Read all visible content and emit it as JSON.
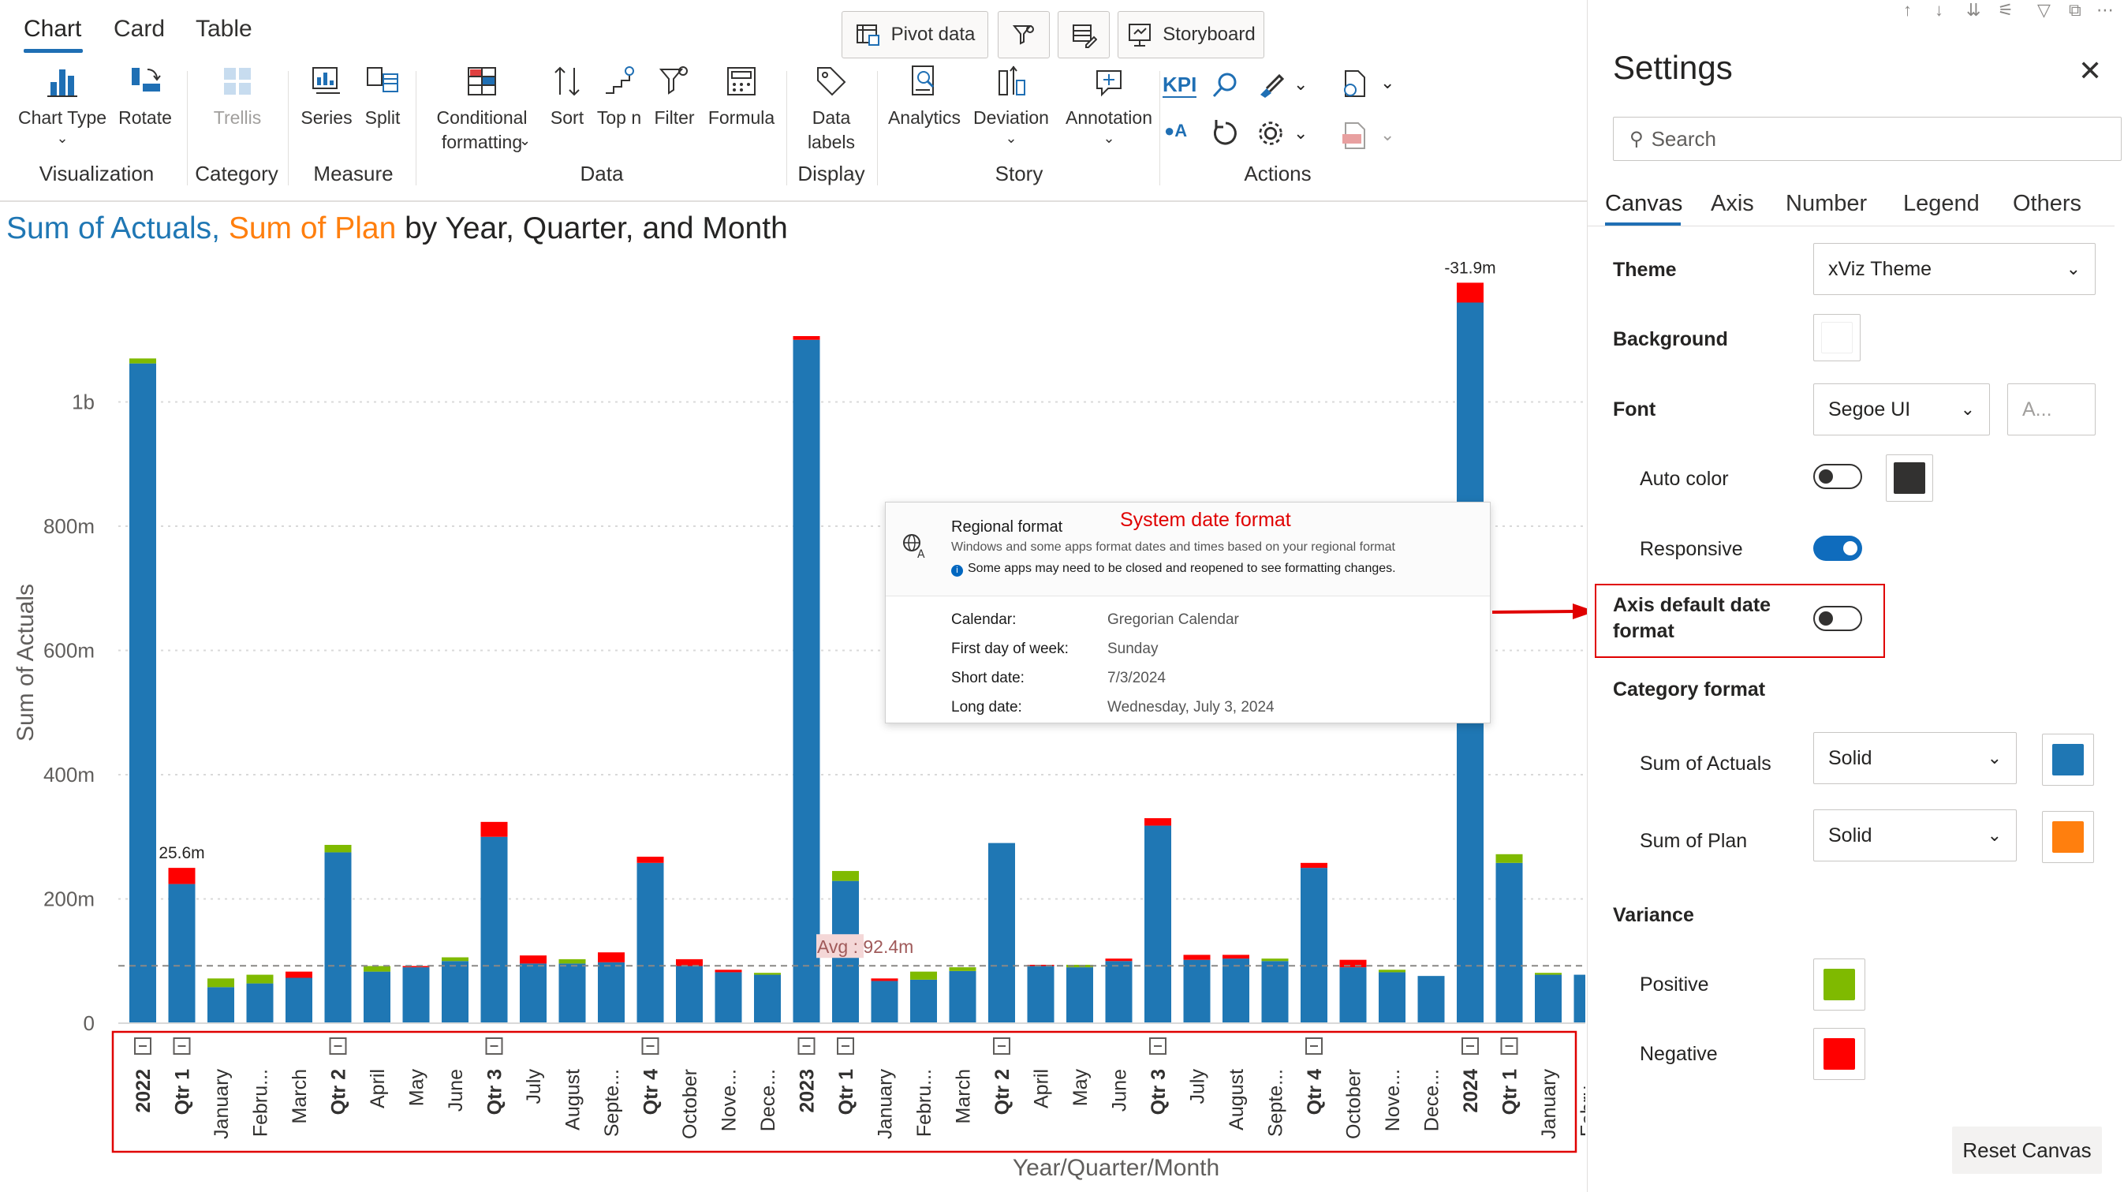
{
  "ribbon": {
    "tabs": [
      "Chart",
      "Card",
      "Table"
    ],
    "top_buttons": {
      "pivot": "Pivot data",
      "storyboard": "Storyboard"
    },
    "buttons": {
      "chart_type": "Chart Type",
      "rotate": "Rotate",
      "trellis": "Trellis",
      "series": "Series",
      "split": "Split",
      "conditional_1": "Conditional",
      "conditional_2": "formatting",
      "sort": "Sort",
      "topn": "Top n",
      "filter": "Filter",
      "formula": "Formula",
      "data_labels_1": "Data",
      "data_labels_2": "labels",
      "analytics": "Analytics",
      "deviation": "Deviation",
      "annotation": "Annotation",
      "kpi": "KPI",
      "kpi_a": "A"
    },
    "groups": {
      "visualization": "Visualization",
      "category": "Category",
      "measure": "Measure",
      "data": "Data",
      "display": "Display",
      "story": "Story",
      "actions": "Actions"
    }
  },
  "chart_title": {
    "part1": "Sum of Actuals",
    "sep": ", ",
    "part2": "Sum of Plan",
    "part3": " by Year, Quarter, and Month"
  },
  "chart_data": {
    "type": "bar",
    "stacked_variance": true,
    "ylabel": "Sum of Actuals",
    "xlabel": "Year/Quarter/Month",
    "ylim": [
      0,
      1200
    ],
    "y_unit": "m",
    "yticks": [
      0,
      200,
      400,
      600,
      800,
      1000
    ],
    "ytick_labels": [
      "0",
      "200m",
      "400m",
      "600m",
      "800m",
      "1b"
    ],
    "categories": [
      "2022",
      "Qtr 1",
      "January",
      "Febru...",
      "March",
      "Qtr 2",
      "April",
      "May",
      "June",
      "Qtr 3",
      "July",
      "August",
      "Septe...",
      "Qtr 4",
      "October",
      "Nove...",
      "Dece...",
      "2023",
      "Qtr 1",
      "January",
      "Febru...",
      "March",
      "Qtr 2",
      "April",
      "May",
      "June",
      "Qtr 3",
      "July",
      "August",
      "Septe...",
      "Qtr 4",
      "October",
      "Nove...",
      "Dece...",
      "2024",
      "Qtr 1",
      "January",
      "Febru..."
    ],
    "bold_categories": [
      "2022",
      "2023",
      "2024",
      "Qtr 1",
      "Qtr 2",
      "Qtr 3",
      "Qtr 4"
    ],
    "series": [
      {
        "name": "Sum of Actuals",
        "values": [
          1062,
          224,
          58,
          64,
          73,
          275,
          83,
          90,
          100,
          300,
          96,
          96,
          98,
          258,
          92,
          82,
          78,
          1100,
          229,
          68,
          70,
          84,
          290,
          92,
          90,
          100,
          318,
          102,
          104,
          100,
          250,
          90,
          82,
          76,
          1160,
          258,
          78,
          78
        ]
      },
      {
        "name": "Variance",
        "values": [
          8,
          -26,
          14,
          14,
          -10,
          12,
          9,
          -2,
          6,
          -24,
          -13,
          7,
          -16,
          -10,
          -11,
          -4,
          3,
          -6,
          16,
          -4,
          13,
          6,
          0,
          -2,
          4,
          -4,
          -12,
          -8,
          -6,
          4,
          -8,
          -12,
          4,
          0,
          -31.9,
          14,
          3,
          0
        ]
      }
    ],
    "data_labels": [
      {
        "category": "Qtr 1",
        "text": "25.6m"
      },
      {
        "category": "2024",
        "text": "-31.9m"
      }
    ],
    "avg_line": {
      "value": 92.4,
      "label": "Avg : 92.4m"
    },
    "colors": {
      "actual": "#1f77b4",
      "plan": "#ff7f0e",
      "positive": "#7fba00",
      "negative": "#ff0000"
    },
    "grid": true
  },
  "regional_popup": {
    "title": "Regional format",
    "subtitle": "Windows and some apps format dates and times based on your regional format",
    "note": "Some apps may need to be closed and reopened to see formatting changes.",
    "annotation": "System date format",
    "rows": [
      {
        "label": "Calendar:",
        "value": "Gregorian Calendar"
      },
      {
        "label": "First day of week:",
        "value": "Sunday"
      },
      {
        "label": "Short date:",
        "value": "7/3/2024"
      },
      {
        "label": "Long date:",
        "value": "Wednesday, July 3, 2024"
      }
    ]
  },
  "settings": {
    "title": "Settings",
    "search_placeholder": "Search",
    "tabs": [
      "Canvas",
      "Axis",
      "Number",
      "Legend",
      "Others"
    ],
    "theme_label": "Theme",
    "theme_value": "xViz Theme",
    "background_label": "Background",
    "font_label": "Font",
    "font_value": "Segoe UI",
    "font_size_placeholder": "A...",
    "auto_color_label": "Auto color",
    "auto_color_on": false,
    "responsive_label": "Responsive",
    "responsive_on": true,
    "axis_date_label_1": "Axis default date",
    "axis_date_label_2": "format",
    "axis_date_on": false,
    "category_format_label": "Category format",
    "sum_actuals_label": "Sum of Actuals",
    "sum_actuals_style": "Solid",
    "sum_actuals_color": "#1f77b4",
    "sum_plan_label": "Sum of Plan",
    "sum_plan_style": "Solid",
    "sum_plan_color": "#ff7f0e",
    "variance_label": "Variance",
    "positive_label": "Positive",
    "positive_color": "#7fba00",
    "negative_label": "Negative",
    "negative_color": "#ff0000",
    "reset_label": "Reset Canvas"
  }
}
